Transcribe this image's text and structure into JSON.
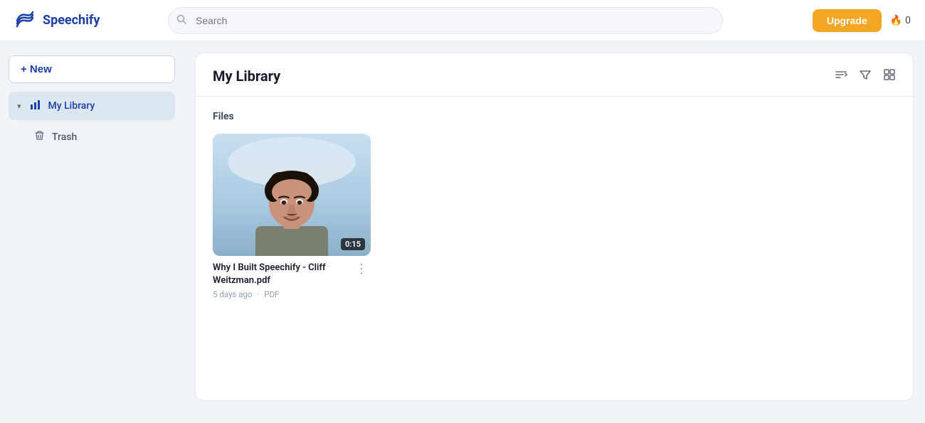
{
  "app": {
    "name": "Speechify",
    "logo_alt": "Speechify logo"
  },
  "topnav": {
    "search_placeholder": "Search",
    "upgrade_label": "Upgrade",
    "fire_count": "0"
  },
  "sidebar": {
    "new_label": "+ New",
    "items": [
      {
        "id": "my-library",
        "label": "My Library",
        "icon": "chart-bar",
        "active": true
      },
      {
        "id": "trash",
        "label": "Trash",
        "icon": "trash",
        "active": false
      }
    ]
  },
  "main": {
    "title": "My Library",
    "sections": [
      {
        "label": "Files",
        "files": [
          {
            "name": "Why I Built Speechify - Cliff Weitzman.pdf",
            "age": "5 days ago",
            "type": "PDF",
            "duration": "0:15",
            "thumb_bg": "#b8cde0"
          }
        ]
      }
    ]
  },
  "icons": {
    "sort": "⇅",
    "filter": "⬡",
    "grid": "⊞",
    "search": "🔍",
    "fire": "🔥",
    "more": "⋮",
    "chevron_down": "▾",
    "plus": "+"
  }
}
